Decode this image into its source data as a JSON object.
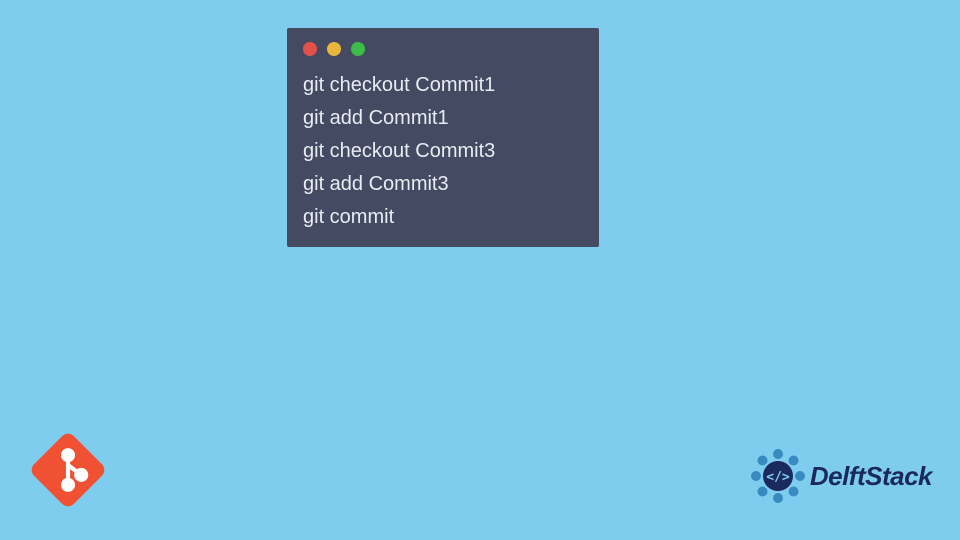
{
  "terminal": {
    "lines": [
      "git checkout Commit1",
      "git add Commit1",
      "git checkout Commit3",
      "git add Commit3",
      "git commit"
    ]
  },
  "logos": {
    "git": "git-logo-icon",
    "brand_name": "DelftStack"
  },
  "colors": {
    "background": "#7ecdee",
    "terminal_bg": "#434a62",
    "terminal_text": "#e9ecf3",
    "git_orange": "#f05133",
    "brand_blue": "#1a2a5e",
    "brand_accent": "#2c7fb8"
  }
}
